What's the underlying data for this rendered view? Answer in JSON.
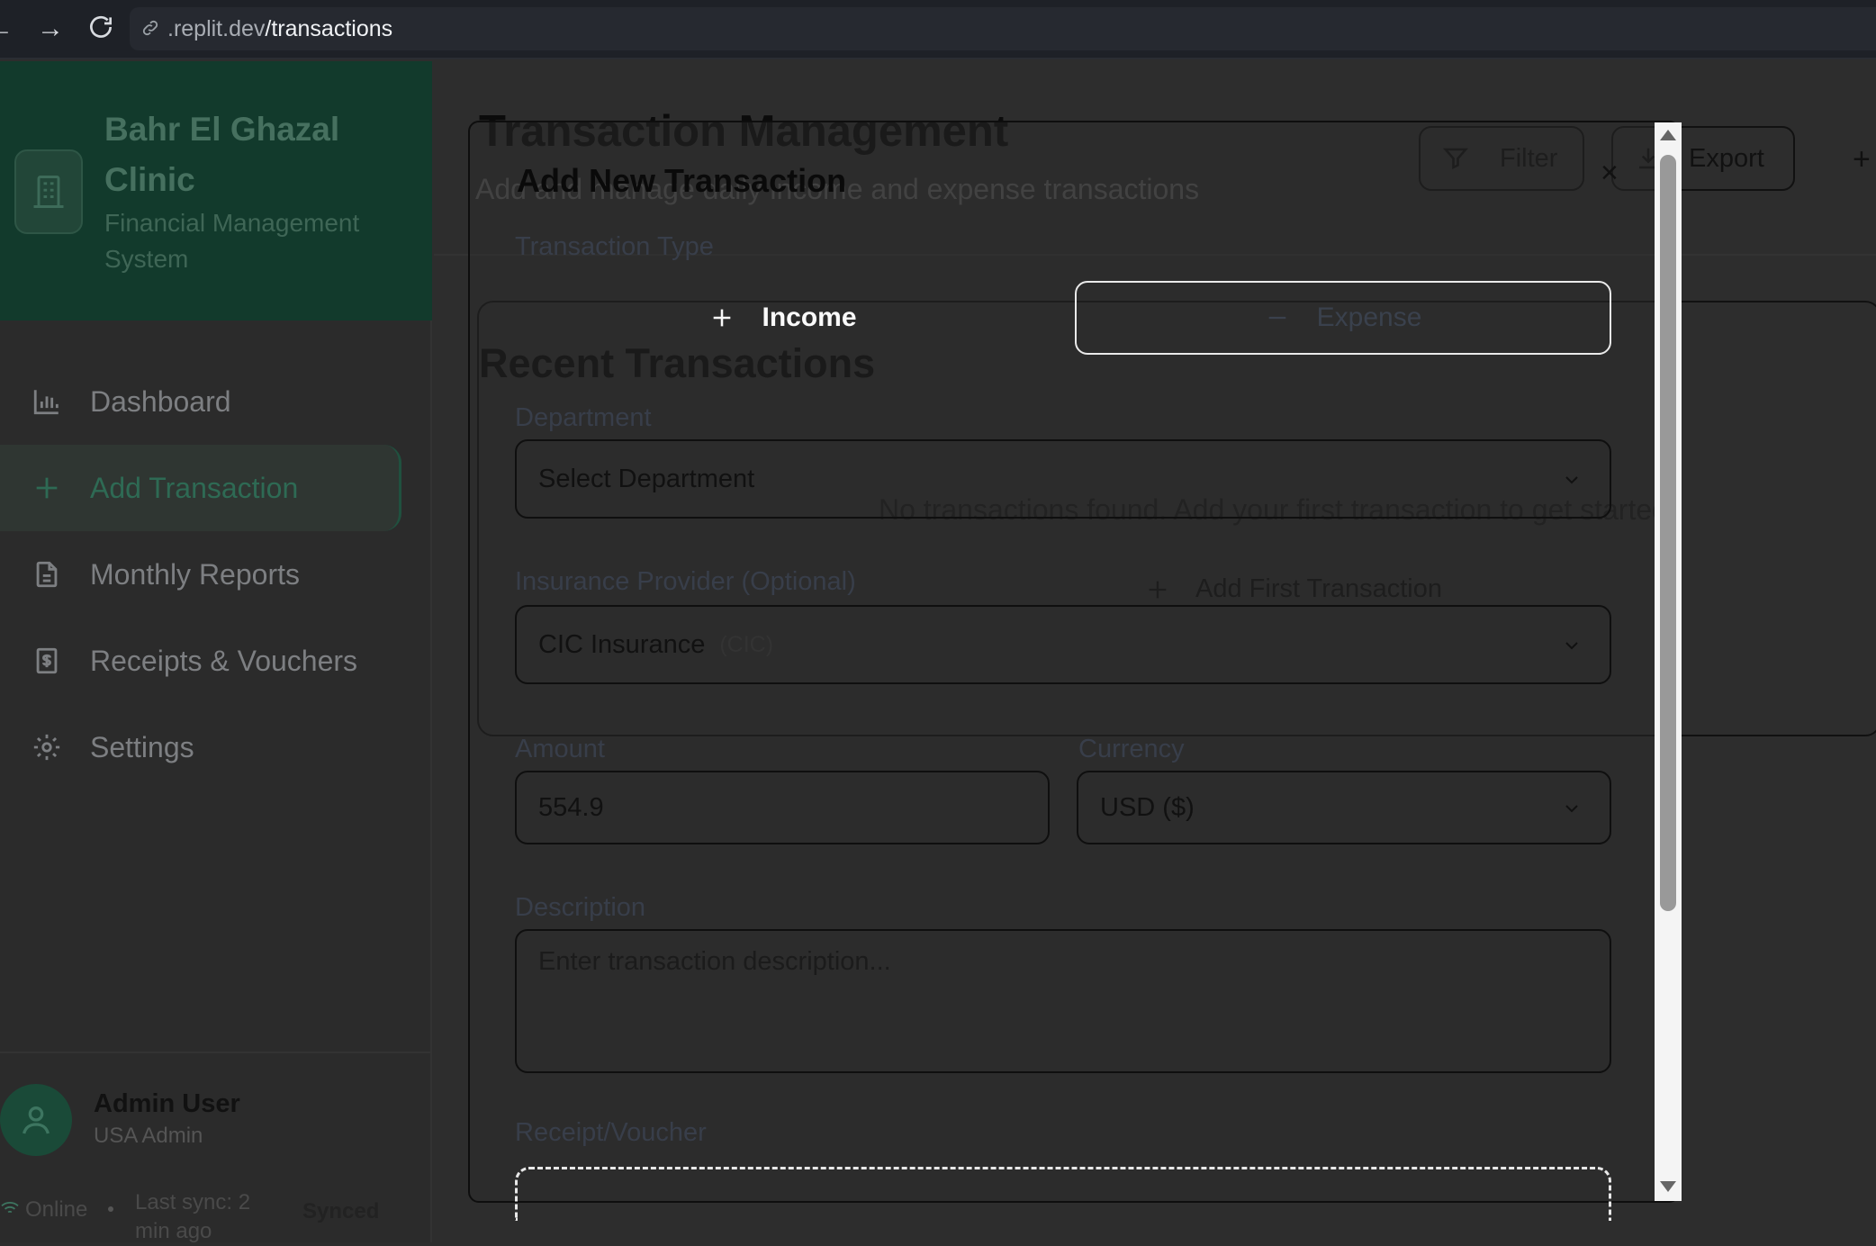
{
  "browser": {
    "url_domain": ".replit.dev",
    "url_path": "/transactions"
  },
  "sidebar": {
    "brand_title": "Bahr El Ghazal Clinic",
    "brand_subtitle": "Financial Management System",
    "items": [
      {
        "label": "Dashboard",
        "icon": "bar-chart-icon"
      },
      {
        "label": "Add Transaction",
        "icon": "plus-icon",
        "active": true
      },
      {
        "label": "Monthly Reports",
        "icon": "document-icon"
      },
      {
        "label": "Receipts & Vouchers",
        "icon": "receipt-icon"
      },
      {
        "label": "Settings",
        "icon": "gear-icon"
      }
    ],
    "user": {
      "name": "Admin User",
      "role": "USA Admin"
    },
    "status": {
      "online": "Online",
      "last_sync": "Last sync: 2 min ago",
      "synced": "Synced"
    }
  },
  "main": {
    "title": "Transaction Management",
    "subtitle": "Add and manage daily income and expense transactions",
    "filter_label": "Filter",
    "export_label": "Export",
    "recent_title": "Recent Transactions",
    "empty_message": "No transactions found. Add your first transaction to get started.",
    "add_first_label": "Add First Transaction"
  },
  "modal": {
    "title": "Add New Transaction",
    "type_label": "Transaction Type",
    "income_label": "Income",
    "expense_label": "Expense",
    "department_label": "Department",
    "department_value": "Select Department",
    "insurance_label": "Insurance Provider (Optional)",
    "insurance_value": "CIC Insurance",
    "insurance_code": "(CIC)",
    "amount_label": "Amount",
    "amount_value": "554.9",
    "currency_label": "Currency",
    "currency_value": "USD ($)",
    "description_label": "Description",
    "description_placeholder": "Enter transaction description...",
    "receipt_label": "Receipt/Voucher"
  },
  "colors": {
    "brand_bg": "#123a2c",
    "accent": "#2e6a54",
    "overlay_bg": "#2d2d2d"
  }
}
